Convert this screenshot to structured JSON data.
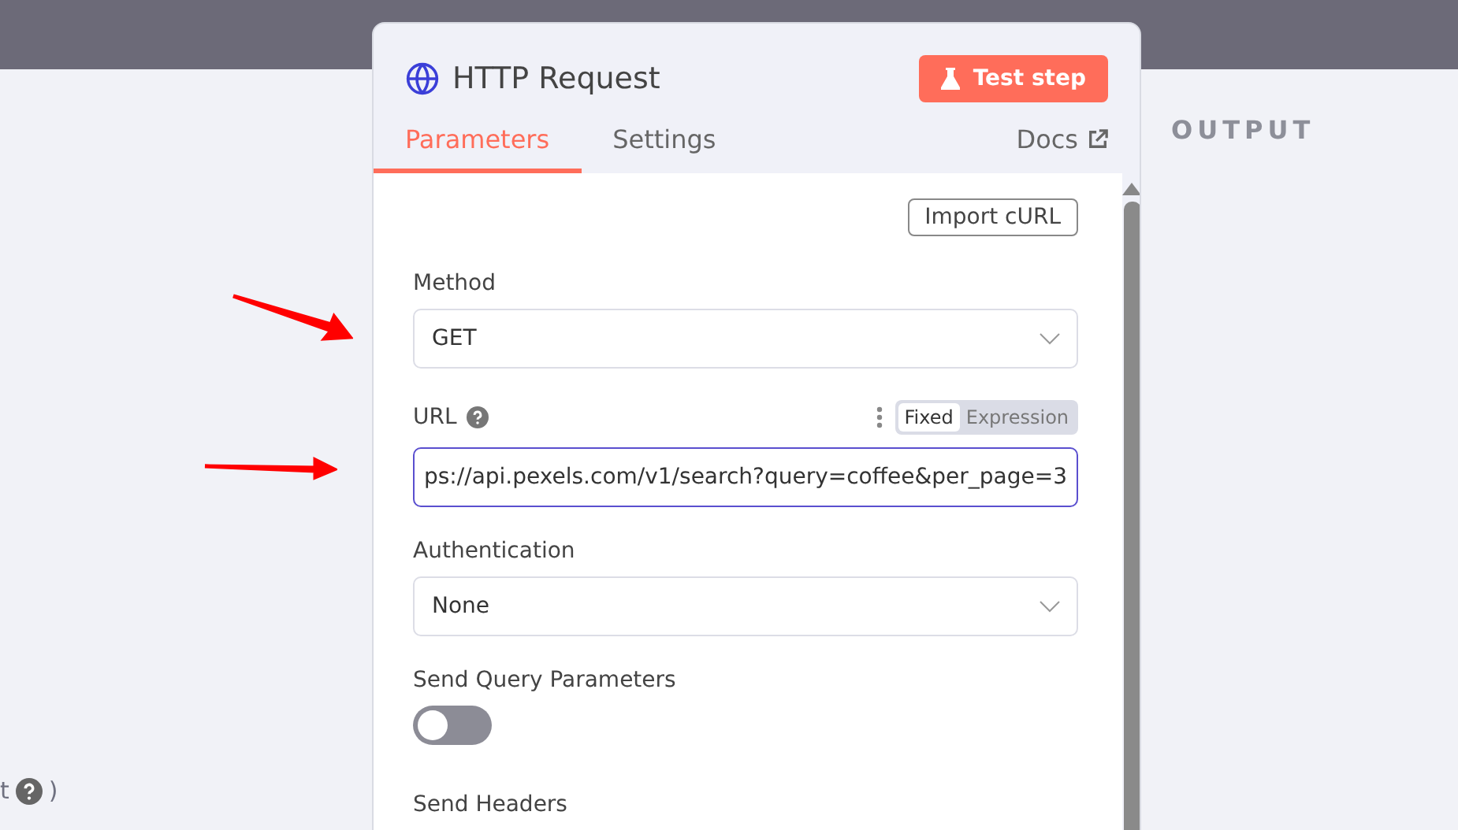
{
  "background": {
    "output_label": "OUTPUT",
    "left_fragment": {
      "before": "t",
      "after": ")"
    }
  },
  "panel": {
    "title": "HTTP Request",
    "test_button": "Test step",
    "tabs": [
      {
        "label": "Parameters",
        "selected": true
      },
      {
        "label": "Settings",
        "selected": false
      }
    ],
    "docs_link": "Docs",
    "import_button": "Import cURL",
    "fields": [
      {
        "kind": "select",
        "label": "Method",
        "value": "GET"
      },
      {
        "kind": "text",
        "label": "URL",
        "help": true,
        "modes": [
          {
            "label": "Fixed",
            "selected": true
          },
          {
            "label": "Expression",
            "selected": false
          }
        ],
        "value": "ps://api.pexels.com/v1/search?query=coffee&per_page=3",
        "focused": true
      },
      {
        "kind": "select",
        "label": "Authentication",
        "value": "None"
      },
      {
        "kind": "toggle",
        "label": "Send Query Parameters",
        "on": false
      },
      {
        "kind": "label",
        "label": "Send Headers"
      }
    ]
  }
}
